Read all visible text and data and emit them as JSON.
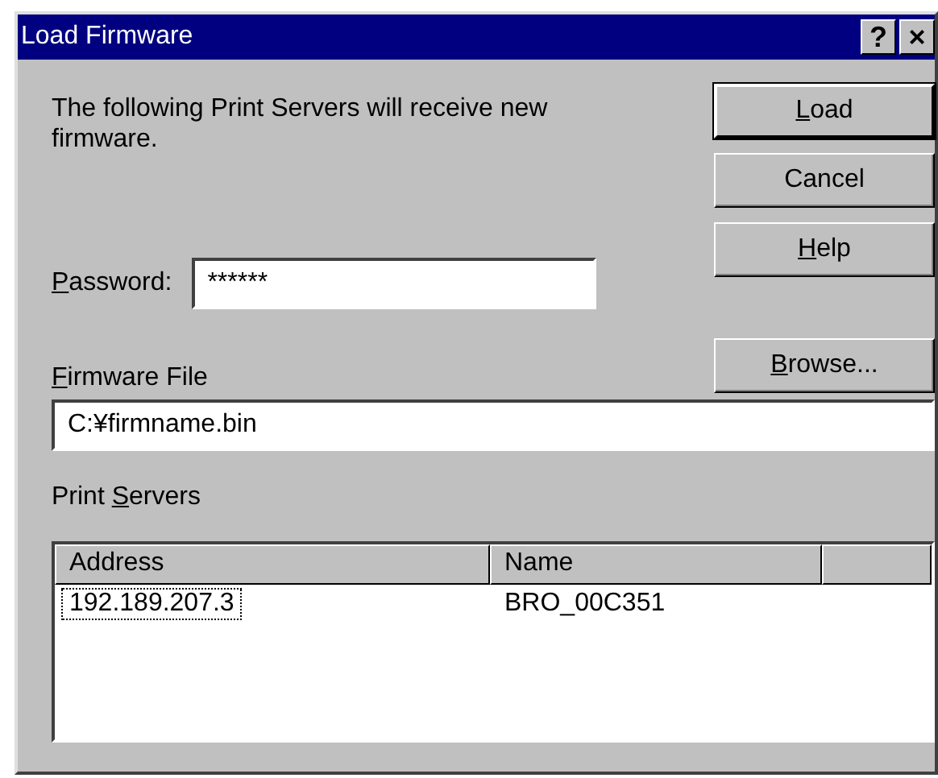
{
  "window": {
    "title": "Load Firmware",
    "title_buttons": [
      "?",
      "×"
    ]
  },
  "message": "The following Print Servers will receive new firmware.",
  "buttons": [
    {
      "key": "L",
      "post": "oad",
      "default": true
    },
    {
      "pre": "Cancel",
      "default": false
    },
    {
      "key": "H",
      "post": "elp",
      "default": false
    }
  ],
  "password": {
    "label": {
      "key": "P",
      "post": "assword:"
    },
    "value": "******"
  },
  "browse_button": {
    "key": "B",
    "post": "rowse..."
  },
  "firmware_file": {
    "label": {
      "key": "F",
      "post": "irmware File"
    },
    "value": "C:¥firmname.bin"
  },
  "print_servers": {
    "label": {
      "pre": "Print ",
      "key": "S",
      "post": "ervers"
    },
    "columns": [
      "Address",
      "Name"
    ],
    "rows": [
      {
        "address": "192.189.207.3",
        "name": "BRO_00C351",
        "focused": true
      }
    ]
  }
}
